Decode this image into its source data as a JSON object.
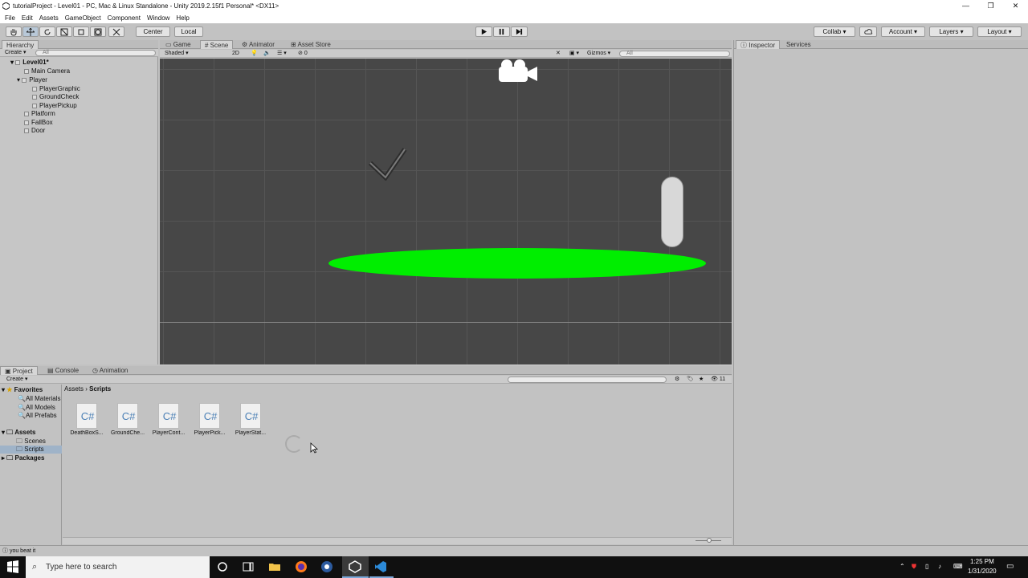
{
  "window": {
    "title": "tutorialProject - Level01 - PC, Mac & Linux Standalone - Unity 2019.2.15f1 Personal* <DX11>",
    "controls": [
      "—",
      "❐",
      "✕"
    ]
  },
  "menu": [
    "File",
    "Edit",
    "Assets",
    "GameObject",
    "Component",
    "Window",
    "Help"
  ],
  "toolbar": {
    "pivot": "Center",
    "space": "Local",
    "collab": "Collab",
    "account": "Account",
    "layers": "Layers",
    "layout": "Layout"
  },
  "hierarchy": {
    "tab": "Hierarchy",
    "create": "Create",
    "search_placeholder": "All",
    "scene": "Level01*",
    "items": [
      {
        "label": "Main Camera"
      },
      {
        "label": "Player"
      },
      {
        "label": "PlayerGraphic"
      },
      {
        "label": "GroundCheck"
      },
      {
        "label": "PlayerPickup"
      },
      {
        "label": "Platform"
      },
      {
        "label": "FallBox"
      },
      {
        "label": "Door"
      }
    ]
  },
  "scene_tabs": [
    "Game",
    "Scene",
    "Animator",
    "Asset Store"
  ],
  "scene_bar": {
    "shading": "Shaded",
    "mode2d": "2D",
    "fx_count": "0",
    "gizmos": "Gizmos",
    "search_placeholder": "All"
  },
  "inspector_tabs": [
    "Inspector",
    "Services"
  ],
  "bottom_tabs": [
    "Project",
    "Console",
    "Animation"
  ],
  "project": {
    "create": "Create",
    "breadcrumb": [
      "Assets",
      "Scripts"
    ],
    "count": "11",
    "favorites": "Favorites",
    "favorite_items": [
      "All Materials",
      "All Models",
      "All Prefabs"
    ],
    "assets_root": "Assets",
    "asset_folders": [
      "Scenes",
      "Scripts"
    ],
    "packages": "Packages",
    "files": [
      {
        "icon": "C#",
        "name": "DeathBoxS..."
      },
      {
        "icon": "C#",
        "name": "GroundChe..."
      },
      {
        "icon": "C#",
        "name": "PlayerCont..."
      },
      {
        "icon": "C#",
        "name": "PlayerPick..."
      },
      {
        "icon": "C#",
        "name": "PlayerStat..."
      }
    ]
  },
  "status": "you beat it",
  "taskbar": {
    "search_placeholder": "Type here to search",
    "time": "1:25 PM",
    "date": "1/31/2020"
  },
  "colors": {
    "platform": "#00ee00",
    "scene_bg": "#474747",
    "editor_bg": "#c2c2c2"
  }
}
